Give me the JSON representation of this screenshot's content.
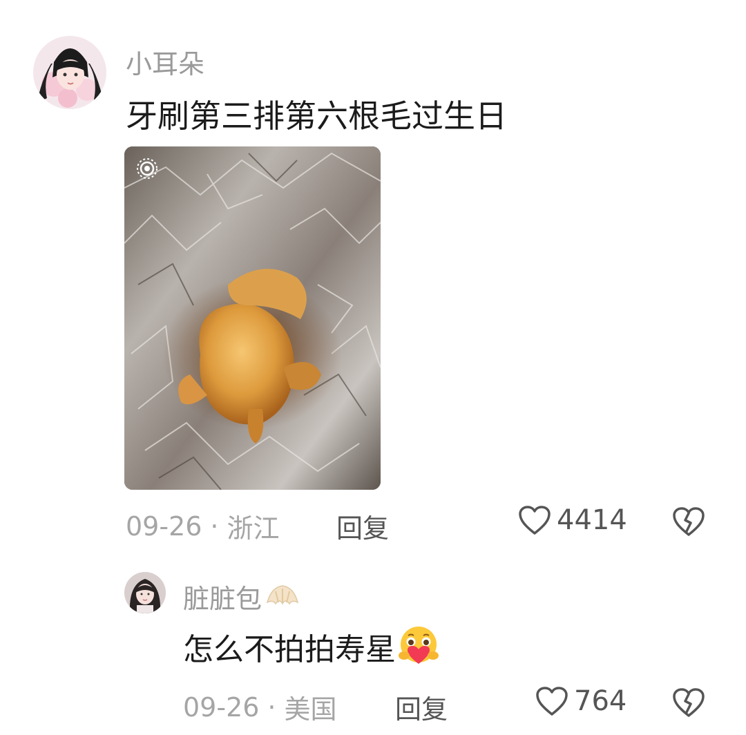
{
  "comments": [
    {
      "username": "小耳朵",
      "text": "牙刷第三排第六根毛过生日",
      "date": "09-26",
      "location": "浙江",
      "separator": "·",
      "reply_label": "回复",
      "likes": "4414",
      "has_image": true
    },
    {
      "username": "脏脏包",
      "username_emoji": "croissant",
      "text": "怎么不拍拍寿星",
      "text_emoji": "smiling-face-with-heart",
      "date": "09-26",
      "location": "美国",
      "separator": "·",
      "reply_label": "回复",
      "likes": "764",
      "is_reply": true
    }
  ],
  "colors": {
    "background": "#ffffff",
    "username": "#9a9a9a",
    "content": "#1b1b1b",
    "meta": "#a5a5a5",
    "action": "#555555"
  }
}
